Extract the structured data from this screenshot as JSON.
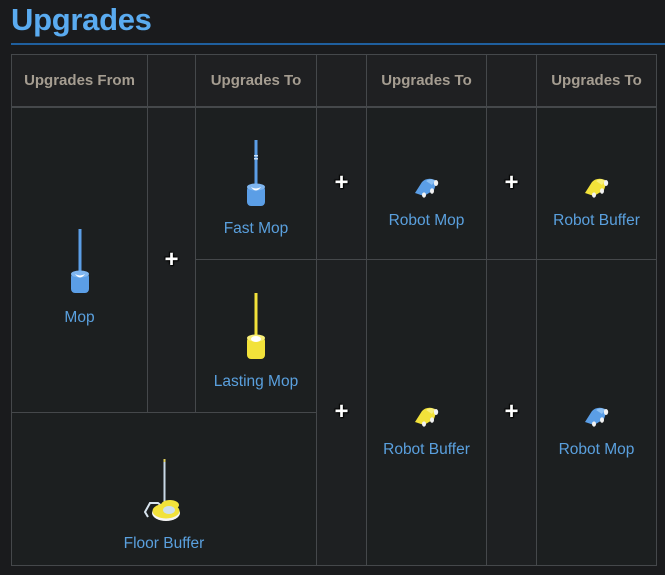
{
  "section": {
    "title": "Upgrades"
  },
  "table": {
    "headers": [
      "Upgrades From",
      "",
      "Upgrades To",
      "",
      "Upgrades To",
      "",
      "Upgrades To"
    ],
    "plus_symbol": "+",
    "items": {
      "mop": {
        "label": "Mop",
        "icon": "mop-icon",
        "color": "#5b9ee6"
      },
      "fast_mop": {
        "label": "Fast Mop",
        "icon": "fast-mop-icon",
        "color": "#5b9ee6"
      },
      "lasting_mop": {
        "label": "Lasting Mop",
        "icon": "lasting-mop-icon",
        "color": "#f2e23a"
      },
      "floor_buffer": {
        "label": "Floor Buffer",
        "icon": "floor-buffer-icon",
        "color": "#f2e23a"
      },
      "robot_mop_1": {
        "label": "Robot Mop",
        "icon": "robot-mop-icon",
        "color": "#5b9ee6"
      },
      "robot_buffer_1": {
        "label": "Robot Buffer",
        "icon": "robot-buffer-icon",
        "color": "#f2e23a"
      },
      "robot_buffer_2": {
        "label": "Robot Buffer",
        "icon": "robot-buffer-icon",
        "color": "#f2e23a"
      },
      "robot_mop_2": {
        "label": "Robot Mop",
        "icon": "robot-mop-icon",
        "color": "#5b9ee6"
      }
    }
  },
  "colors": {
    "title": "#5aabf0",
    "link": "#5aa0de",
    "header_text": "#a59d91",
    "blue_item": "#5b9ee6",
    "yellow_item": "#f2e23a"
  }
}
